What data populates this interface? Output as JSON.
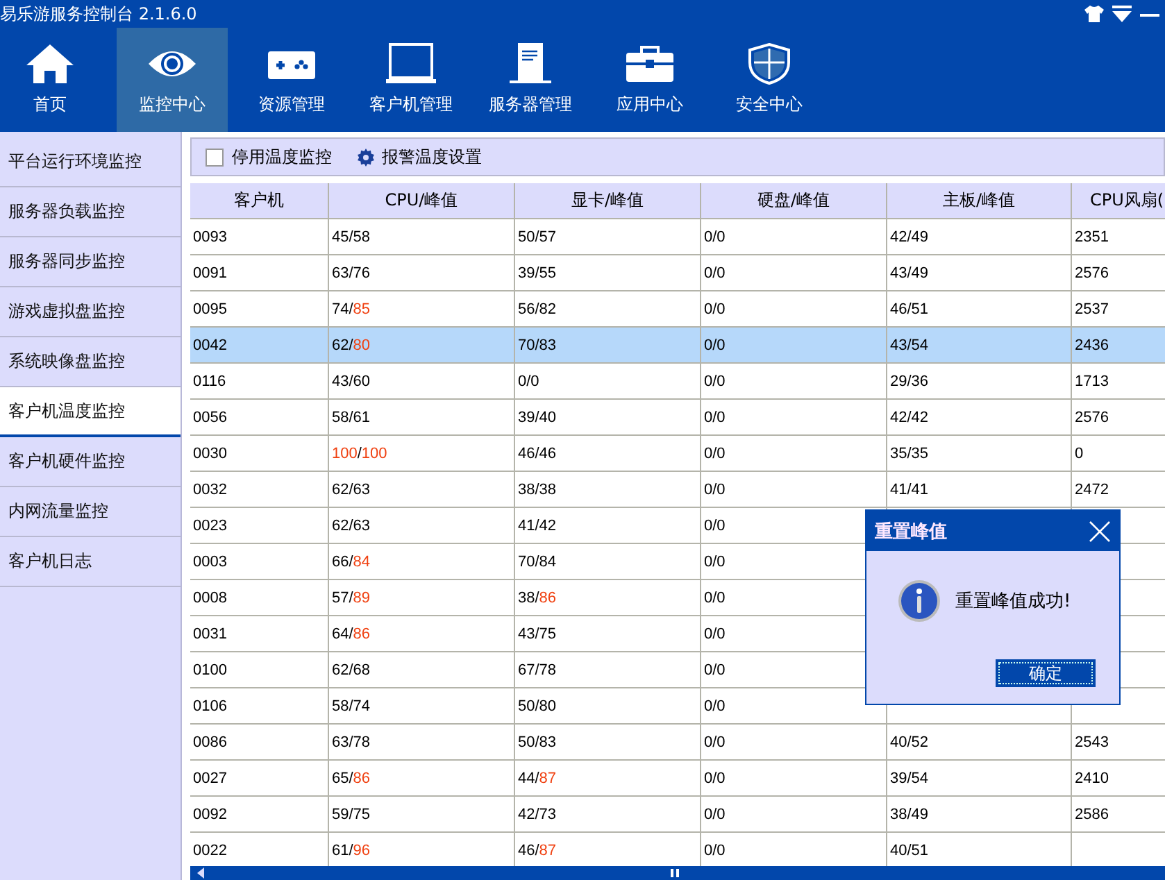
{
  "window": {
    "title": "易乐游服务控制台 2.1.6.0"
  },
  "nav": [
    {
      "label": "首页",
      "selected": false
    },
    {
      "label": "监控中心",
      "selected": true
    },
    {
      "label": "资源管理",
      "selected": false
    },
    {
      "label": "客户机管理",
      "selected": false
    },
    {
      "label": "服务器管理",
      "selected": false
    },
    {
      "label": "应用中心",
      "selected": false
    },
    {
      "label": "安全中心",
      "selected": false
    }
  ],
  "sidebar": {
    "items": [
      {
        "label": "平台运行环境监控",
        "selected": false
      },
      {
        "label": "服务器负载监控",
        "selected": false
      },
      {
        "label": "服务器同步监控",
        "selected": false
      },
      {
        "label": "游戏虚拟盘监控",
        "selected": false
      },
      {
        "label": "系统映像盘监控",
        "selected": false
      },
      {
        "label": "客户机温度监控",
        "selected": true
      },
      {
        "label": "客户机硬件监控",
        "selected": false
      },
      {
        "label": "内网流量监控",
        "selected": false
      },
      {
        "label": "客户机日志",
        "selected": false
      }
    ]
  },
  "toolbar": {
    "disable_checkbox": {
      "label": "停用温度监控",
      "checked": false
    },
    "alarm_button": "报警温度设置"
  },
  "table": {
    "columns": [
      "客户机",
      "CPU/峰值",
      "显卡/峰值",
      "硬盘/峰值",
      "主板/峰值",
      "CPU风扇("
    ],
    "rows": [
      {
        "selected": false,
        "cells": [
          "0093",
          "45/58",
          "50/57",
          "0/0",
          "42/49",
          "2351"
        ]
      },
      {
        "selected": false,
        "cells": [
          "0091",
          "63/76",
          "39/55",
          "0/0",
          "43/49",
          "2576"
        ]
      },
      {
        "selected": false,
        "cells": [
          "0095",
          [
            {
              "text": "74/",
              "hot": false
            },
            {
              "text": "85",
              "hot": true
            }
          ],
          "56/82",
          "0/0",
          "46/51",
          "2537"
        ]
      },
      {
        "selected": true,
        "cells": [
          "0042",
          [
            {
              "text": "62/",
              "hot": false
            },
            {
              "text": "80",
              "hot": true
            }
          ],
          "70/83",
          "0/0",
          "43/54",
          "2436"
        ]
      },
      {
        "selected": false,
        "cells": [
          "0116",
          "43/60",
          "0/0",
          "0/0",
          "29/36",
          "1713"
        ]
      },
      {
        "selected": false,
        "cells": [
          "0056",
          "58/61",
          "39/40",
          "0/0",
          "42/42",
          "2576"
        ]
      },
      {
        "selected": false,
        "cells": [
          "0030",
          [
            {
              "text": "100",
              "hot": true
            },
            {
              "text": "/",
              "hot": false
            },
            {
              "text": "100",
              "hot": true
            }
          ],
          "46/46",
          "0/0",
          "35/35",
          "0"
        ]
      },
      {
        "selected": false,
        "cells": [
          "0032",
          "62/63",
          "38/38",
          "0/0",
          "41/41",
          "2472"
        ]
      },
      {
        "selected": false,
        "cells": [
          "0023",
          "62/63",
          "41/42",
          "0/0"
        ]
      },
      {
        "selected": false,
        "cells": [
          "0003",
          [
            {
              "text": "66/",
              "hot": false
            },
            {
              "text": "84",
              "hot": true
            }
          ],
          "70/84",
          "0/0"
        ]
      },
      {
        "selected": false,
        "cells": [
          "0008",
          [
            {
              "text": "57/",
              "hot": false
            },
            {
              "text": "89",
              "hot": true
            }
          ],
          [
            {
              "text": "38/",
              "hot": false
            },
            {
              "text": "86",
              "hot": true
            }
          ],
          "0/0"
        ]
      },
      {
        "selected": false,
        "cells": [
          "0031",
          [
            {
              "text": "64/",
              "hot": false
            },
            {
              "text": "86",
              "hot": true
            }
          ],
          "43/75",
          "0/0"
        ]
      },
      {
        "selected": false,
        "cells": [
          "0100",
          "62/68",
          "67/78",
          "0/0"
        ]
      },
      {
        "selected": false,
        "cells": [
          "0106",
          "58/74",
          "50/80",
          "0/0"
        ]
      },
      {
        "selected": false,
        "cells": [
          "0086",
          "63/78",
          "50/83",
          "0/0",
          "40/52",
          "2543"
        ]
      },
      {
        "selected": false,
        "cells": [
          "0027",
          [
            {
              "text": "65/",
              "hot": false
            },
            {
              "text": "86",
              "hot": true
            }
          ],
          [
            {
              "text": "44/",
              "hot": false
            },
            {
              "text": "87",
              "hot": true
            }
          ],
          "0/0",
          "39/54",
          "2410"
        ]
      },
      {
        "selected": false,
        "cells": [
          "0092",
          "59/75",
          "42/73",
          "0/0",
          "38/49",
          "2586"
        ]
      },
      {
        "selected": false,
        "cells": [
          "0022",
          [
            {
              "text": "61/",
              "hot": false
            },
            {
              "text": "96",
              "hot": true
            }
          ],
          [
            {
              "text": "46/",
              "hot": false
            },
            {
              "text": "87",
              "hot": true
            }
          ],
          "0/0",
          "40/51"
        ]
      }
    ]
  },
  "dialog": {
    "title": "重置峰值",
    "message": "重置峰值成功!",
    "button": "确定"
  }
}
